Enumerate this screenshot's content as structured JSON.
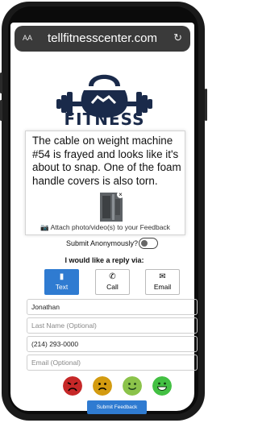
{
  "browser": {
    "text_size_label": "AA",
    "url": "tellfitnesscenter.com",
    "reload_icon": "reload-icon"
  },
  "brand": {
    "name": "FITNESS",
    "logo_icon": "kettlebell-dumbbell-icon"
  },
  "feedback": {
    "text": "The cable on weight machine #54 is frayed and looks like it's about to snap. One of the foam handle covers is also torn.",
    "attach_label": "Attach photo/video(s) to your Feedback"
  },
  "anonymous": {
    "label": "Submit Anonymously?",
    "checked": false
  },
  "reply": {
    "heading": "I would like a reply via:",
    "options": [
      {
        "label": "Text",
        "icon": "chat-icon",
        "selected": true
      },
      {
        "label": "Call",
        "icon": "phone-icon",
        "selected": false
      },
      {
        "label": "Email",
        "icon": "envelope-icon",
        "selected": false
      }
    ]
  },
  "form": {
    "first_name": "Jonathan",
    "last_name_placeholder": "Last Name (Optional)",
    "phone": "(214) 293-0000",
    "email_placeholder": "Email (Optional)"
  },
  "ratings": [
    {
      "name": "angry",
      "color": "#c62828"
    },
    {
      "name": "sad",
      "color": "#d39b10"
    },
    {
      "name": "happy",
      "color": "#8bc34a"
    },
    {
      "name": "very-happy",
      "color": "#43c043"
    }
  ],
  "submit_label": "Submit Feedback",
  "colors": {
    "accent": "#2f7bd1",
    "brand_navy": "#1a2a4a"
  }
}
